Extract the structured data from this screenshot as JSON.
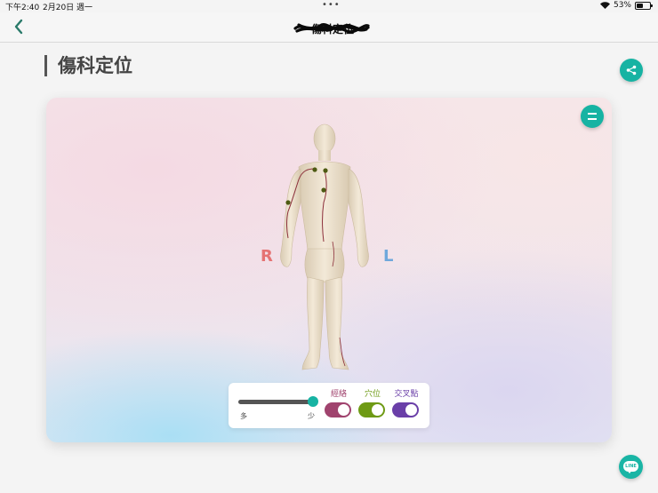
{
  "status_bar": {
    "time": "下午2:40",
    "date": "2月20日 週一",
    "battery": "53%",
    "battery_level": 0.53
  },
  "nav": {
    "title": "傷科定位"
  },
  "page": {
    "title": "傷科定位"
  },
  "body_view": {
    "right_label": "R",
    "left_label": "L"
  },
  "controls": {
    "slider_min_label": "多",
    "slider_max_label": "少",
    "slider_value": 1.0,
    "toggles": [
      {
        "label": "經絡",
        "on": true,
        "color": "#a0436e"
      },
      {
        "label": "穴位",
        "on": true,
        "color": "#6e9a14"
      },
      {
        "label": "交叉點",
        "on": true,
        "color": "#6a3fa8"
      }
    ]
  },
  "colors": {
    "accent": "#17b3a3",
    "meridian_line": "#8c2f3a",
    "acupoint": "#4d5a12"
  },
  "icons": {
    "back": "chevron-left-icon",
    "share": "share-icon",
    "menu": "menu-icon",
    "line": "line-chat-icon"
  },
  "line_button": {
    "label": "LINE"
  }
}
